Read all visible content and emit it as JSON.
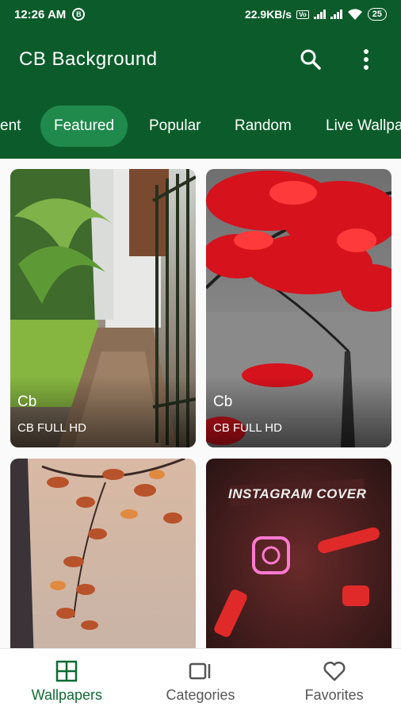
{
  "status_bar": {
    "time": "12:26 AM",
    "notification_badge": "B",
    "network_speed": "22.9KB/s",
    "volte": "VoLTE",
    "battery": "25"
  },
  "app_bar": {
    "title": "CB Background",
    "search_icon": "search-icon",
    "more_icon": "more-vert-icon"
  },
  "tabs": [
    {
      "label": "ent",
      "active": false
    },
    {
      "label": "Featured",
      "active": true
    },
    {
      "label": "Popular",
      "active": false
    },
    {
      "label": "Random",
      "active": false
    },
    {
      "label": "Live Wallpa",
      "active": false
    }
  ],
  "cards": [
    {
      "title": "Cb",
      "subtitle": "CB FULL HD"
    },
    {
      "title": "Cb",
      "subtitle": "CB FULL HD"
    },
    {
      "image_text": "INSTAGRAM COVER"
    }
  ],
  "bottom_nav": [
    {
      "label": "Wallpapers",
      "icon": "grid-icon",
      "active": true
    },
    {
      "label": "Categories",
      "icon": "categories-icon",
      "active": false
    },
    {
      "label": "Favorites",
      "icon": "heart-icon",
      "active": false
    }
  ],
  "colors": {
    "primary": "#0c5c2b",
    "tab_active": "#1f8a4c",
    "nav_active": "#0f6b34"
  }
}
